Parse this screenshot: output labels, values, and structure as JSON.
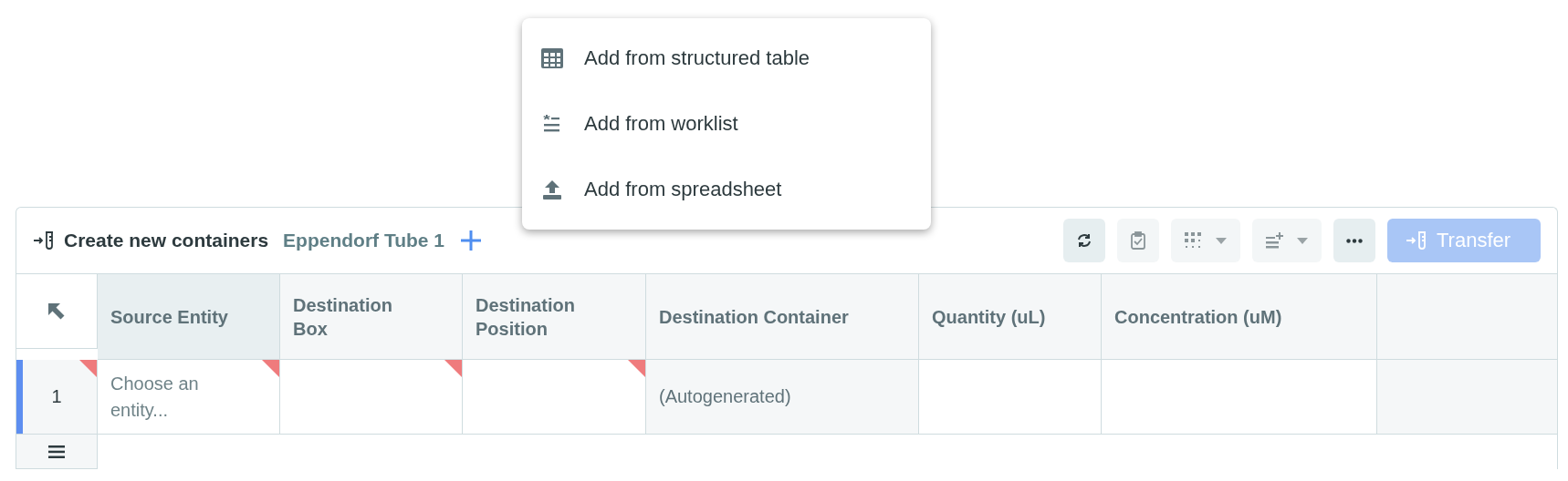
{
  "panel": {
    "title": "Create new containers",
    "subtitle": "Eppendorf Tube 1",
    "toolbar": [
      {
        "kind": "refresh",
        "active": true
      },
      {
        "kind": "clipboard",
        "active": false
      },
      {
        "kind": "grid",
        "active": false
      },
      {
        "kind": "list",
        "active": false
      },
      {
        "kind": "more",
        "active": true
      }
    ],
    "transfer_button": {
      "label": "Transfer",
      "disabled": true
    }
  },
  "add_menu": {
    "items": [
      {
        "kind": "table",
        "label": "Add from structured table"
      },
      {
        "kind": "worklist",
        "label": "Add from worklist"
      },
      {
        "kind": "upload",
        "label": "Add from spreadsheet"
      }
    ]
  },
  "table": {
    "columns": [
      {
        "label": "Source Entity",
        "selected": true
      },
      {
        "label": "Destination Box",
        "selected": false
      },
      {
        "label": "Destination Position",
        "selected": false
      },
      {
        "label": "Destination Container",
        "selected": false
      },
      {
        "label": "Quantity (uL)",
        "selected": false
      },
      {
        "label": "Concentration (uM)",
        "selected": false
      }
    ],
    "rows": [
      {
        "number": "1",
        "selected": true,
        "required": true,
        "cells": [
          {
            "kind": "entry",
            "placeholder": "Choose an entity...",
            "required": true
          },
          {
            "kind": "entry",
            "required": true
          },
          {
            "kind": "entry",
            "required": true
          },
          {
            "kind": "auto",
            "text": "(Autogenerated)"
          },
          {
            "kind": "entry"
          },
          {
            "kind": "entry"
          }
        ]
      }
    ]
  }
}
